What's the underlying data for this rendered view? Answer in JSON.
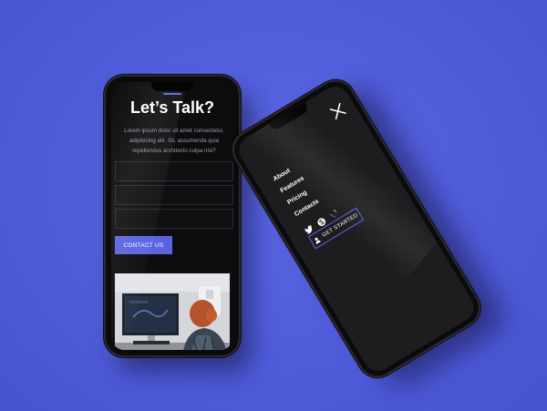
{
  "contact_screen": {
    "title": "Let’s Talk?",
    "description": "Lorem ipsum dolor sit amet consectetur, adipisicing elit. Sit, assumenda quia repellendus architecto culpa nisi?",
    "fields": [
      {
        "placeholder": ""
      },
      {
        "placeholder": ""
      },
      {
        "placeholder": ""
      }
    ],
    "contact_button": "CONTACT US",
    "photo_icon": "person-at-computer-photo"
  },
  "menu_screen": {
    "items": [
      "About",
      "Features",
      "Pricing",
      "Contacts"
    ],
    "social_icons": [
      "twitter-icon",
      "skype-icon",
      "vimeo-icon"
    ],
    "cta_button": "GET STARTED",
    "cta_icon": "user-icon",
    "close_icon": "close-icon"
  },
  "colors": {
    "background": "#4f5bd9",
    "accent": "#5a64e0",
    "screen_dark": "#0d0d0f",
    "menu_screen": "#1d1d20"
  }
}
